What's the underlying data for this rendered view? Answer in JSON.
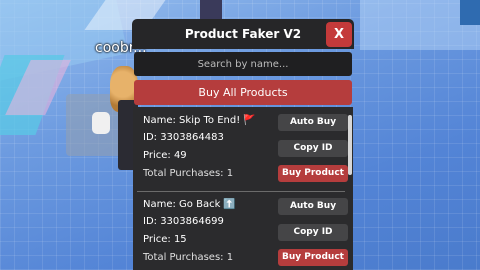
{
  "game": {
    "player_tag": "coobr..."
  },
  "gui": {
    "title": "Product Faker V2",
    "close_label": "X",
    "search_placeholder": "Search by name...",
    "buy_all_label": "Buy All Products",
    "products": [
      {
        "name_line": "Name: Skip To End!",
        "emoji": "🚩",
        "id_line": "ID: 3303864483",
        "price_line": "Price: 49",
        "total_line": "Total Purchases: 1",
        "auto_buy_label": "Auto Buy",
        "copy_id_label": "Copy ID",
        "buy_product_label": "Buy Product"
      },
      {
        "name_line": "Name: Go Back",
        "emoji": "⬆️",
        "id_line": "ID: 3303864699",
        "price_line": "Price: 15",
        "total_line": "Total Purchases: 1",
        "auto_buy_label": "Auto Buy",
        "copy_id_label": "Copy ID",
        "buy_product_label": "Buy Product"
      }
    ]
  },
  "colors": {
    "panel_dark": "#262628",
    "list_bg": "#2b2b2d",
    "accent_red": "#b53d3d",
    "close_red": "#c43a3a",
    "button_grey": "#454547"
  }
}
